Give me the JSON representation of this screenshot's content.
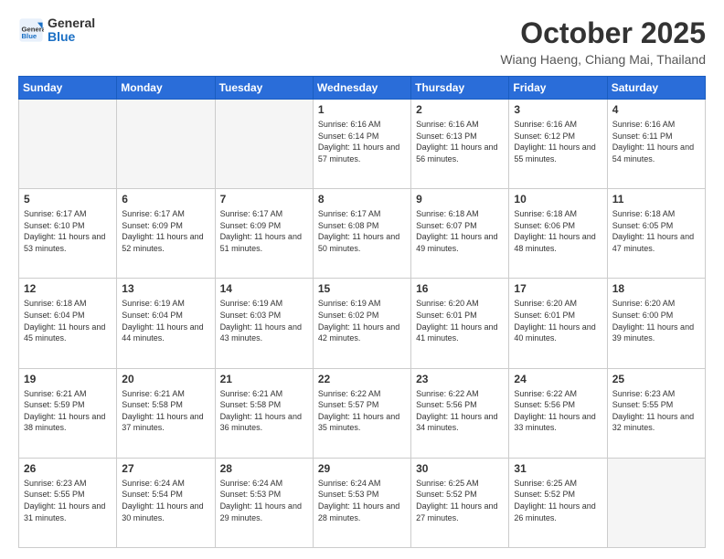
{
  "header": {
    "logo_general": "General",
    "logo_blue": "Blue",
    "month_title": "October 2025",
    "subtitle": "Wiang Haeng, Chiang Mai, Thailand"
  },
  "days_of_week": [
    "Sunday",
    "Monday",
    "Tuesday",
    "Wednesday",
    "Thursday",
    "Friday",
    "Saturday"
  ],
  "weeks": [
    [
      {
        "day": "",
        "empty": true
      },
      {
        "day": "",
        "empty": true
      },
      {
        "day": "",
        "empty": true
      },
      {
        "day": "1",
        "sunrise": "6:16 AM",
        "sunset": "6:14 PM",
        "daylight": "11 hours and 57 minutes."
      },
      {
        "day": "2",
        "sunrise": "6:16 AM",
        "sunset": "6:13 PM",
        "daylight": "11 hours and 56 minutes."
      },
      {
        "day": "3",
        "sunrise": "6:16 AM",
        "sunset": "6:12 PM",
        "daylight": "11 hours and 55 minutes."
      },
      {
        "day": "4",
        "sunrise": "6:16 AM",
        "sunset": "6:11 PM",
        "daylight": "11 hours and 54 minutes."
      }
    ],
    [
      {
        "day": "5",
        "sunrise": "6:17 AM",
        "sunset": "6:10 PM",
        "daylight": "11 hours and 53 minutes."
      },
      {
        "day": "6",
        "sunrise": "6:17 AM",
        "sunset": "6:09 PM",
        "daylight": "11 hours and 52 minutes."
      },
      {
        "day": "7",
        "sunrise": "6:17 AM",
        "sunset": "6:09 PM",
        "daylight": "11 hours and 51 minutes."
      },
      {
        "day": "8",
        "sunrise": "6:17 AM",
        "sunset": "6:08 PM",
        "daylight": "11 hours and 50 minutes."
      },
      {
        "day": "9",
        "sunrise": "6:18 AM",
        "sunset": "6:07 PM",
        "daylight": "11 hours and 49 minutes."
      },
      {
        "day": "10",
        "sunrise": "6:18 AM",
        "sunset": "6:06 PM",
        "daylight": "11 hours and 48 minutes."
      },
      {
        "day": "11",
        "sunrise": "6:18 AM",
        "sunset": "6:05 PM",
        "daylight": "11 hours and 47 minutes."
      }
    ],
    [
      {
        "day": "12",
        "sunrise": "6:18 AM",
        "sunset": "6:04 PM",
        "daylight": "11 hours and 45 minutes."
      },
      {
        "day": "13",
        "sunrise": "6:19 AM",
        "sunset": "6:04 PM",
        "daylight": "11 hours and 44 minutes."
      },
      {
        "day": "14",
        "sunrise": "6:19 AM",
        "sunset": "6:03 PM",
        "daylight": "11 hours and 43 minutes."
      },
      {
        "day": "15",
        "sunrise": "6:19 AM",
        "sunset": "6:02 PM",
        "daylight": "11 hours and 42 minutes."
      },
      {
        "day": "16",
        "sunrise": "6:20 AM",
        "sunset": "6:01 PM",
        "daylight": "11 hours and 41 minutes."
      },
      {
        "day": "17",
        "sunrise": "6:20 AM",
        "sunset": "6:01 PM",
        "daylight": "11 hours and 40 minutes."
      },
      {
        "day": "18",
        "sunrise": "6:20 AM",
        "sunset": "6:00 PM",
        "daylight": "11 hours and 39 minutes."
      }
    ],
    [
      {
        "day": "19",
        "sunrise": "6:21 AM",
        "sunset": "5:59 PM",
        "daylight": "11 hours and 38 minutes."
      },
      {
        "day": "20",
        "sunrise": "6:21 AM",
        "sunset": "5:58 PM",
        "daylight": "11 hours and 37 minutes."
      },
      {
        "day": "21",
        "sunrise": "6:21 AM",
        "sunset": "5:58 PM",
        "daylight": "11 hours and 36 minutes."
      },
      {
        "day": "22",
        "sunrise": "6:22 AM",
        "sunset": "5:57 PM",
        "daylight": "11 hours and 35 minutes."
      },
      {
        "day": "23",
        "sunrise": "6:22 AM",
        "sunset": "5:56 PM",
        "daylight": "11 hours and 34 minutes."
      },
      {
        "day": "24",
        "sunrise": "6:22 AM",
        "sunset": "5:56 PM",
        "daylight": "11 hours and 33 minutes."
      },
      {
        "day": "25",
        "sunrise": "6:23 AM",
        "sunset": "5:55 PM",
        "daylight": "11 hours and 32 minutes."
      }
    ],
    [
      {
        "day": "26",
        "sunrise": "6:23 AM",
        "sunset": "5:55 PM",
        "daylight": "11 hours and 31 minutes."
      },
      {
        "day": "27",
        "sunrise": "6:24 AM",
        "sunset": "5:54 PM",
        "daylight": "11 hours and 30 minutes."
      },
      {
        "day": "28",
        "sunrise": "6:24 AM",
        "sunset": "5:53 PM",
        "daylight": "11 hours and 29 minutes."
      },
      {
        "day": "29",
        "sunrise": "6:24 AM",
        "sunset": "5:53 PM",
        "daylight": "11 hours and 28 minutes."
      },
      {
        "day": "30",
        "sunrise": "6:25 AM",
        "sunset": "5:52 PM",
        "daylight": "11 hours and 27 minutes."
      },
      {
        "day": "31",
        "sunrise": "6:25 AM",
        "sunset": "5:52 PM",
        "daylight": "11 hours and 26 minutes."
      },
      {
        "day": "",
        "empty": true
      }
    ]
  ]
}
